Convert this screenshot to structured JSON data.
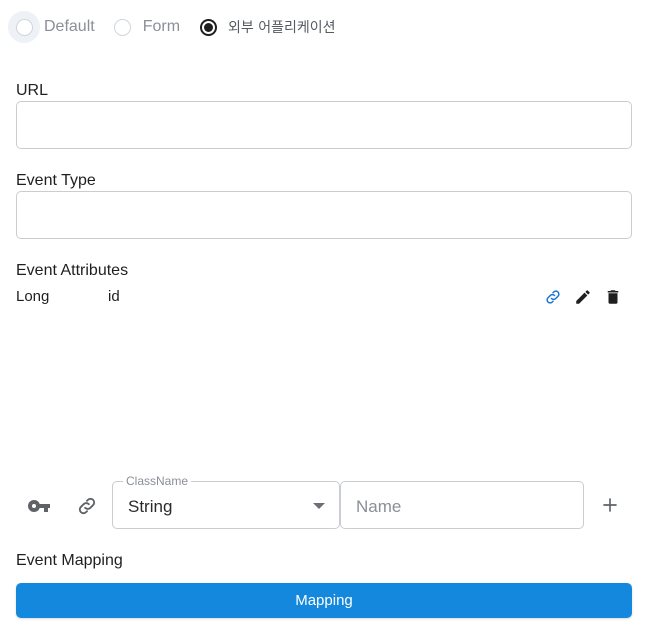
{
  "radio": {
    "options": [
      {
        "label": "Default",
        "checked": false
      },
      {
        "label": "Form",
        "checked": false
      },
      {
        "label": "외부 어플리케이션",
        "checked": true
      }
    ]
  },
  "url": {
    "label": "URL",
    "value": ""
  },
  "event_type": {
    "label": "Event Type",
    "value": ""
  },
  "event_attributes": {
    "label": "Event Attributes",
    "items": [
      {
        "type": "Long",
        "name": "id"
      }
    ]
  },
  "add_attribute": {
    "class_legend": "ClassName",
    "class_value": "String",
    "name_placeholder": "Name"
  },
  "event_mapping": {
    "label": "Event Mapping",
    "button_label": "Mapping"
  },
  "colors": {
    "accent": "#1488dd",
    "link_icon": "#1976d2",
    "text": "#1f1f1f"
  }
}
